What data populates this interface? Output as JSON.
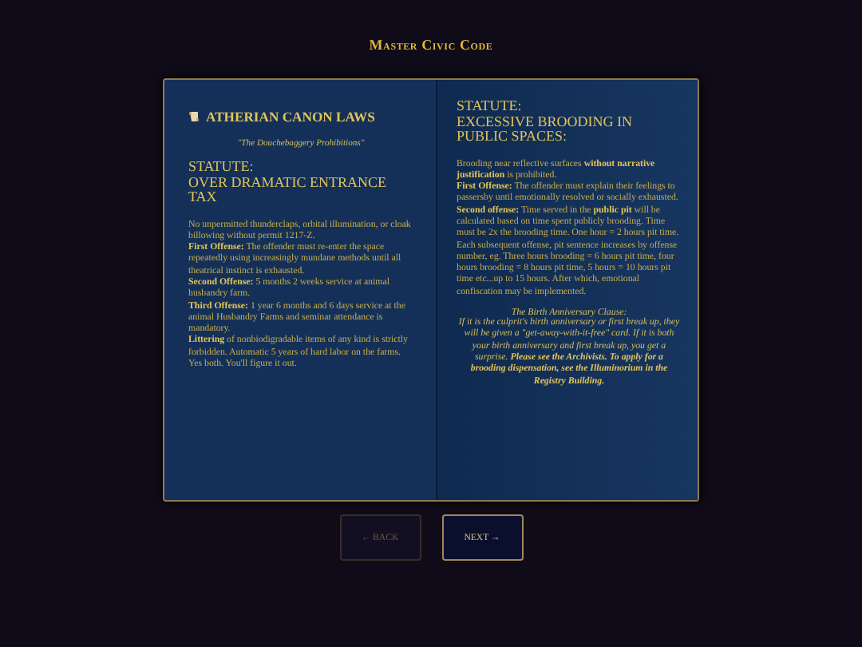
{
  "title": "Master Civic Code",
  "pages": [
    {
      "heading": "ATHERIAN CANON LAWS",
      "subtitle": "\"The Douchebaggery Prohibitions\"",
      "statute_label": "STATUTE:",
      "statute_title": "OVER DRAMATIC ENTRANCE TAX",
      "paragraphs": [
        "No unpermitted thunderclaps, orbital illumination, or cloak billowing without permit 1217-Z.",
        "**First Offense:** The offender must re-enter the space repeatedly using increasingly mundane methods until all theatrical instinct is exhausted.",
        "**Second Offense:** 5 months 2 weeks service at animal husbandry farm.",
        "**Third Offense:** 1 year 6 months and 6 days service at the animal Husbandry Farms and seminar attendance is mandatory.",
        "**Littering** of nonbiodigradable items of any kind is strictly forbidden. Automatic 5 years of hard labor on the farms. Yes both. You'll figure it out."
      ]
    },
    {
      "statute_label": "STATUTE:",
      "statute_title": "EXCESSIVE BROODING IN PUBLIC SPACES:",
      "paragraphs": [
        "Brooding near reflective surfaces **without narrative justification** is prohibited.",
        "**First Offense:** The offender must explain their feelings to passersby until emotionally resolved or socially exhausted.",
        "**Second offense:** Time served in the **public pit** will be calculated based on time spent publicly brooding. Time must be 2x the brooding time. One hour = 2 hours pit time. Each subsequent offense, pit sentence increases by offense number, eg. Three hours brooding = 6 hours pit time, four hours brooding = 8 hours pit time, 5 hours = 10 hours pit time etc...up to 15 hours. After which, emotional confiscation may be implemented."
      ],
      "clause_title": "The Birth Anniversary Clause:",
      "clause": "If it is the culprit's birth anniversary or first break up, they will be given a \"get-away-with-it-free\" card. If it is both your birth anniversary and first break up, you get a surprise. **Please see the Archivists. To apply for a brooding dispensation, see the Illuminorium in the Registry Building.**"
    }
  ],
  "buttons": [
    {
      "label": "← BACK",
      "disabled": true
    },
    {
      "label": "NEXT →",
      "disabled": false
    }
  ]
}
